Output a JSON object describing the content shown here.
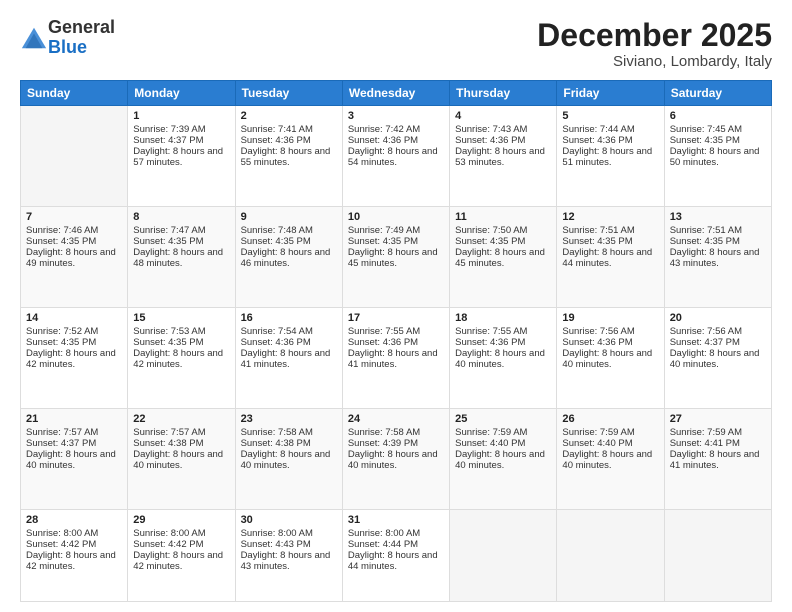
{
  "header": {
    "logo_general": "General",
    "logo_blue": "Blue",
    "month_title": "December 2025",
    "location": "Siviano, Lombardy, Italy"
  },
  "days_of_week": [
    "Sunday",
    "Monday",
    "Tuesday",
    "Wednesday",
    "Thursday",
    "Friday",
    "Saturday"
  ],
  "weeks": [
    [
      {
        "day": "",
        "sunrise": "",
        "sunset": "",
        "daylight": ""
      },
      {
        "day": "1",
        "sunrise": "Sunrise: 7:39 AM",
        "sunset": "Sunset: 4:37 PM",
        "daylight": "Daylight: 8 hours and 57 minutes."
      },
      {
        "day": "2",
        "sunrise": "Sunrise: 7:41 AM",
        "sunset": "Sunset: 4:36 PM",
        "daylight": "Daylight: 8 hours and 55 minutes."
      },
      {
        "day": "3",
        "sunrise": "Sunrise: 7:42 AM",
        "sunset": "Sunset: 4:36 PM",
        "daylight": "Daylight: 8 hours and 54 minutes."
      },
      {
        "day": "4",
        "sunrise": "Sunrise: 7:43 AM",
        "sunset": "Sunset: 4:36 PM",
        "daylight": "Daylight: 8 hours and 53 minutes."
      },
      {
        "day": "5",
        "sunrise": "Sunrise: 7:44 AM",
        "sunset": "Sunset: 4:36 PM",
        "daylight": "Daylight: 8 hours and 51 minutes."
      },
      {
        "day": "6",
        "sunrise": "Sunrise: 7:45 AM",
        "sunset": "Sunset: 4:35 PM",
        "daylight": "Daylight: 8 hours and 50 minutes."
      }
    ],
    [
      {
        "day": "7",
        "sunrise": "Sunrise: 7:46 AM",
        "sunset": "Sunset: 4:35 PM",
        "daylight": "Daylight: 8 hours and 49 minutes."
      },
      {
        "day": "8",
        "sunrise": "Sunrise: 7:47 AM",
        "sunset": "Sunset: 4:35 PM",
        "daylight": "Daylight: 8 hours and 48 minutes."
      },
      {
        "day": "9",
        "sunrise": "Sunrise: 7:48 AM",
        "sunset": "Sunset: 4:35 PM",
        "daylight": "Daylight: 8 hours and 46 minutes."
      },
      {
        "day": "10",
        "sunrise": "Sunrise: 7:49 AM",
        "sunset": "Sunset: 4:35 PM",
        "daylight": "Daylight: 8 hours and 45 minutes."
      },
      {
        "day": "11",
        "sunrise": "Sunrise: 7:50 AM",
        "sunset": "Sunset: 4:35 PM",
        "daylight": "Daylight: 8 hours and 45 minutes."
      },
      {
        "day": "12",
        "sunrise": "Sunrise: 7:51 AM",
        "sunset": "Sunset: 4:35 PM",
        "daylight": "Daylight: 8 hours and 44 minutes."
      },
      {
        "day": "13",
        "sunrise": "Sunrise: 7:51 AM",
        "sunset": "Sunset: 4:35 PM",
        "daylight": "Daylight: 8 hours and 43 minutes."
      }
    ],
    [
      {
        "day": "14",
        "sunrise": "Sunrise: 7:52 AM",
        "sunset": "Sunset: 4:35 PM",
        "daylight": "Daylight: 8 hours and 42 minutes."
      },
      {
        "day": "15",
        "sunrise": "Sunrise: 7:53 AM",
        "sunset": "Sunset: 4:35 PM",
        "daylight": "Daylight: 8 hours and 42 minutes."
      },
      {
        "day": "16",
        "sunrise": "Sunrise: 7:54 AM",
        "sunset": "Sunset: 4:36 PM",
        "daylight": "Daylight: 8 hours and 41 minutes."
      },
      {
        "day": "17",
        "sunrise": "Sunrise: 7:55 AM",
        "sunset": "Sunset: 4:36 PM",
        "daylight": "Daylight: 8 hours and 41 minutes."
      },
      {
        "day": "18",
        "sunrise": "Sunrise: 7:55 AM",
        "sunset": "Sunset: 4:36 PM",
        "daylight": "Daylight: 8 hours and 40 minutes."
      },
      {
        "day": "19",
        "sunrise": "Sunrise: 7:56 AM",
        "sunset": "Sunset: 4:36 PM",
        "daylight": "Daylight: 8 hours and 40 minutes."
      },
      {
        "day": "20",
        "sunrise": "Sunrise: 7:56 AM",
        "sunset": "Sunset: 4:37 PM",
        "daylight": "Daylight: 8 hours and 40 minutes."
      }
    ],
    [
      {
        "day": "21",
        "sunrise": "Sunrise: 7:57 AM",
        "sunset": "Sunset: 4:37 PM",
        "daylight": "Daylight: 8 hours and 40 minutes."
      },
      {
        "day": "22",
        "sunrise": "Sunrise: 7:57 AM",
        "sunset": "Sunset: 4:38 PM",
        "daylight": "Daylight: 8 hours and 40 minutes."
      },
      {
        "day": "23",
        "sunrise": "Sunrise: 7:58 AM",
        "sunset": "Sunset: 4:38 PM",
        "daylight": "Daylight: 8 hours and 40 minutes."
      },
      {
        "day": "24",
        "sunrise": "Sunrise: 7:58 AM",
        "sunset": "Sunset: 4:39 PM",
        "daylight": "Daylight: 8 hours and 40 minutes."
      },
      {
        "day": "25",
        "sunrise": "Sunrise: 7:59 AM",
        "sunset": "Sunset: 4:40 PM",
        "daylight": "Daylight: 8 hours and 40 minutes."
      },
      {
        "day": "26",
        "sunrise": "Sunrise: 7:59 AM",
        "sunset": "Sunset: 4:40 PM",
        "daylight": "Daylight: 8 hours and 40 minutes."
      },
      {
        "day": "27",
        "sunrise": "Sunrise: 7:59 AM",
        "sunset": "Sunset: 4:41 PM",
        "daylight": "Daylight: 8 hours and 41 minutes."
      }
    ],
    [
      {
        "day": "28",
        "sunrise": "Sunrise: 8:00 AM",
        "sunset": "Sunset: 4:42 PM",
        "daylight": "Daylight: 8 hours and 42 minutes."
      },
      {
        "day": "29",
        "sunrise": "Sunrise: 8:00 AM",
        "sunset": "Sunset: 4:42 PM",
        "daylight": "Daylight: 8 hours and 42 minutes."
      },
      {
        "day": "30",
        "sunrise": "Sunrise: 8:00 AM",
        "sunset": "Sunset: 4:43 PM",
        "daylight": "Daylight: 8 hours and 43 minutes."
      },
      {
        "day": "31",
        "sunrise": "Sunrise: 8:00 AM",
        "sunset": "Sunset: 4:44 PM",
        "daylight": "Daylight: 8 hours and 44 minutes."
      },
      {
        "day": "",
        "sunrise": "",
        "sunset": "",
        "daylight": ""
      },
      {
        "day": "",
        "sunrise": "",
        "sunset": "",
        "daylight": ""
      },
      {
        "day": "",
        "sunrise": "",
        "sunset": "",
        "daylight": ""
      }
    ]
  ]
}
